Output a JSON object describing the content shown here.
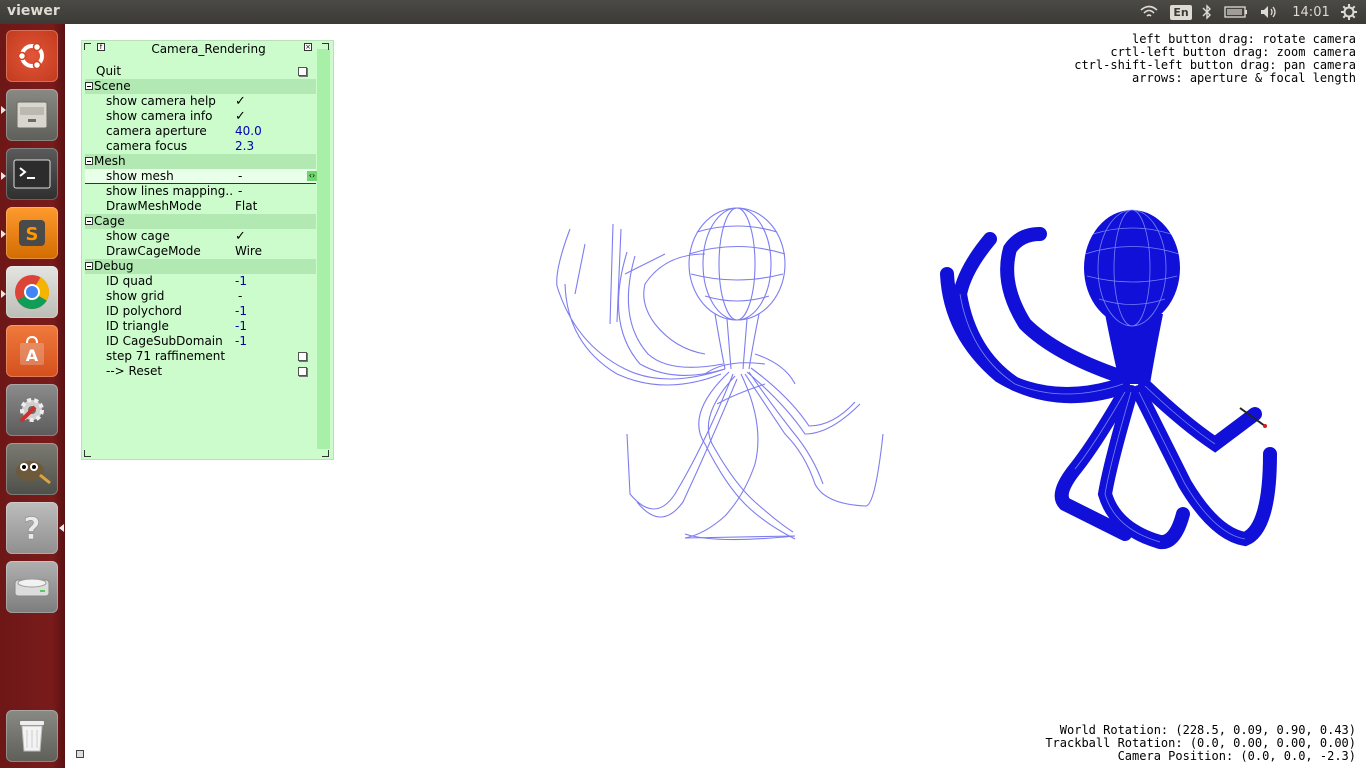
{
  "top_panel": {
    "title": "viewer",
    "keyboard_layout": "En",
    "clock": "14:01",
    "icons": [
      "wifi-icon",
      "keyboard-icon",
      "bluetooth-icon",
      "battery-icon",
      "volume-icon",
      "gear-icon"
    ]
  },
  "launcher": {
    "items": [
      "ubuntu-dash-icon",
      "files-icon",
      "terminal-icon",
      "sublime-text-icon",
      "chrome-icon",
      "software-center-icon",
      "system-settings-icon",
      "gimp-icon",
      "help-icon",
      "drive-icon",
      "trash-icon"
    ],
    "colors": {
      "background": "#7a1b1b"
    }
  },
  "control_panel": {
    "title": "Camera_Rendering",
    "quit_label": "Quit",
    "sections": {
      "scene": {
        "label": "Scene",
        "show_camera_help": {
          "label": "show camera help",
          "value": "✓"
        },
        "show_camera_info": {
          "label": "show camera info",
          "value": "✓"
        },
        "camera_aperture": {
          "label": "camera aperture",
          "value": "40.0"
        },
        "camera_focus": {
          "label": "camera focus",
          "value": "2.3"
        }
      },
      "mesh": {
        "label": "Mesh",
        "show_mesh": {
          "label": "show mesh",
          "value": "-"
        },
        "show_lines_mapping": {
          "label": "show lines mapping..",
          "value": "-"
        },
        "draw_mesh_mode": {
          "label": "DrawMeshMode",
          "value": "Flat"
        }
      },
      "cage": {
        "label": "Cage",
        "show_cage": {
          "label": "show cage",
          "value": "✓"
        },
        "draw_cage_mode": {
          "label": "DrawCageMode",
          "value": "Wire"
        }
      },
      "debug": {
        "label": "Debug",
        "id_quad": {
          "label": "ID quad",
          "value": "-1"
        },
        "show_grid": {
          "label": "show grid",
          "value": "-"
        },
        "id_polychord": {
          "label": "ID polychord",
          "value": "-1"
        },
        "id_triangle": {
          "label": "ID triangle",
          "value": "-1"
        },
        "id_cage_subdomain": {
          "label": "ID CageSubDomain",
          "value": "-1"
        },
        "step_raffinement": {
          "label": "step 71 raffinement"
        },
        "reset": {
          "label": "--> Reset"
        }
      }
    },
    "colors": {
      "background": "#ccfccc",
      "section": "#b2e8b2",
      "number": "#0000b0"
    }
  },
  "camera_help": {
    "lines": [
      "left button drag: rotate camera",
      "crtl-left button drag: zoom camera",
      "ctrl-shift-left button drag: pan camera",
      "arrows: aperture & focal length"
    ]
  },
  "camera_info": {
    "world_rotation": "World Rotation: (228.5, 0.09, 0.90, 0.43)",
    "trackball_rotation": "Trackball Rotation: (0.0, 0.00, 0.00, 0.00)",
    "camera_position": "Camera Position: (0.0, 0.0, -2.3)"
  },
  "viewport": {
    "colors": {
      "wire_cage": "#7d7df0",
      "solid_mesh": "#1010d8",
      "mesh_lines": "#8ea0ff"
    }
  }
}
